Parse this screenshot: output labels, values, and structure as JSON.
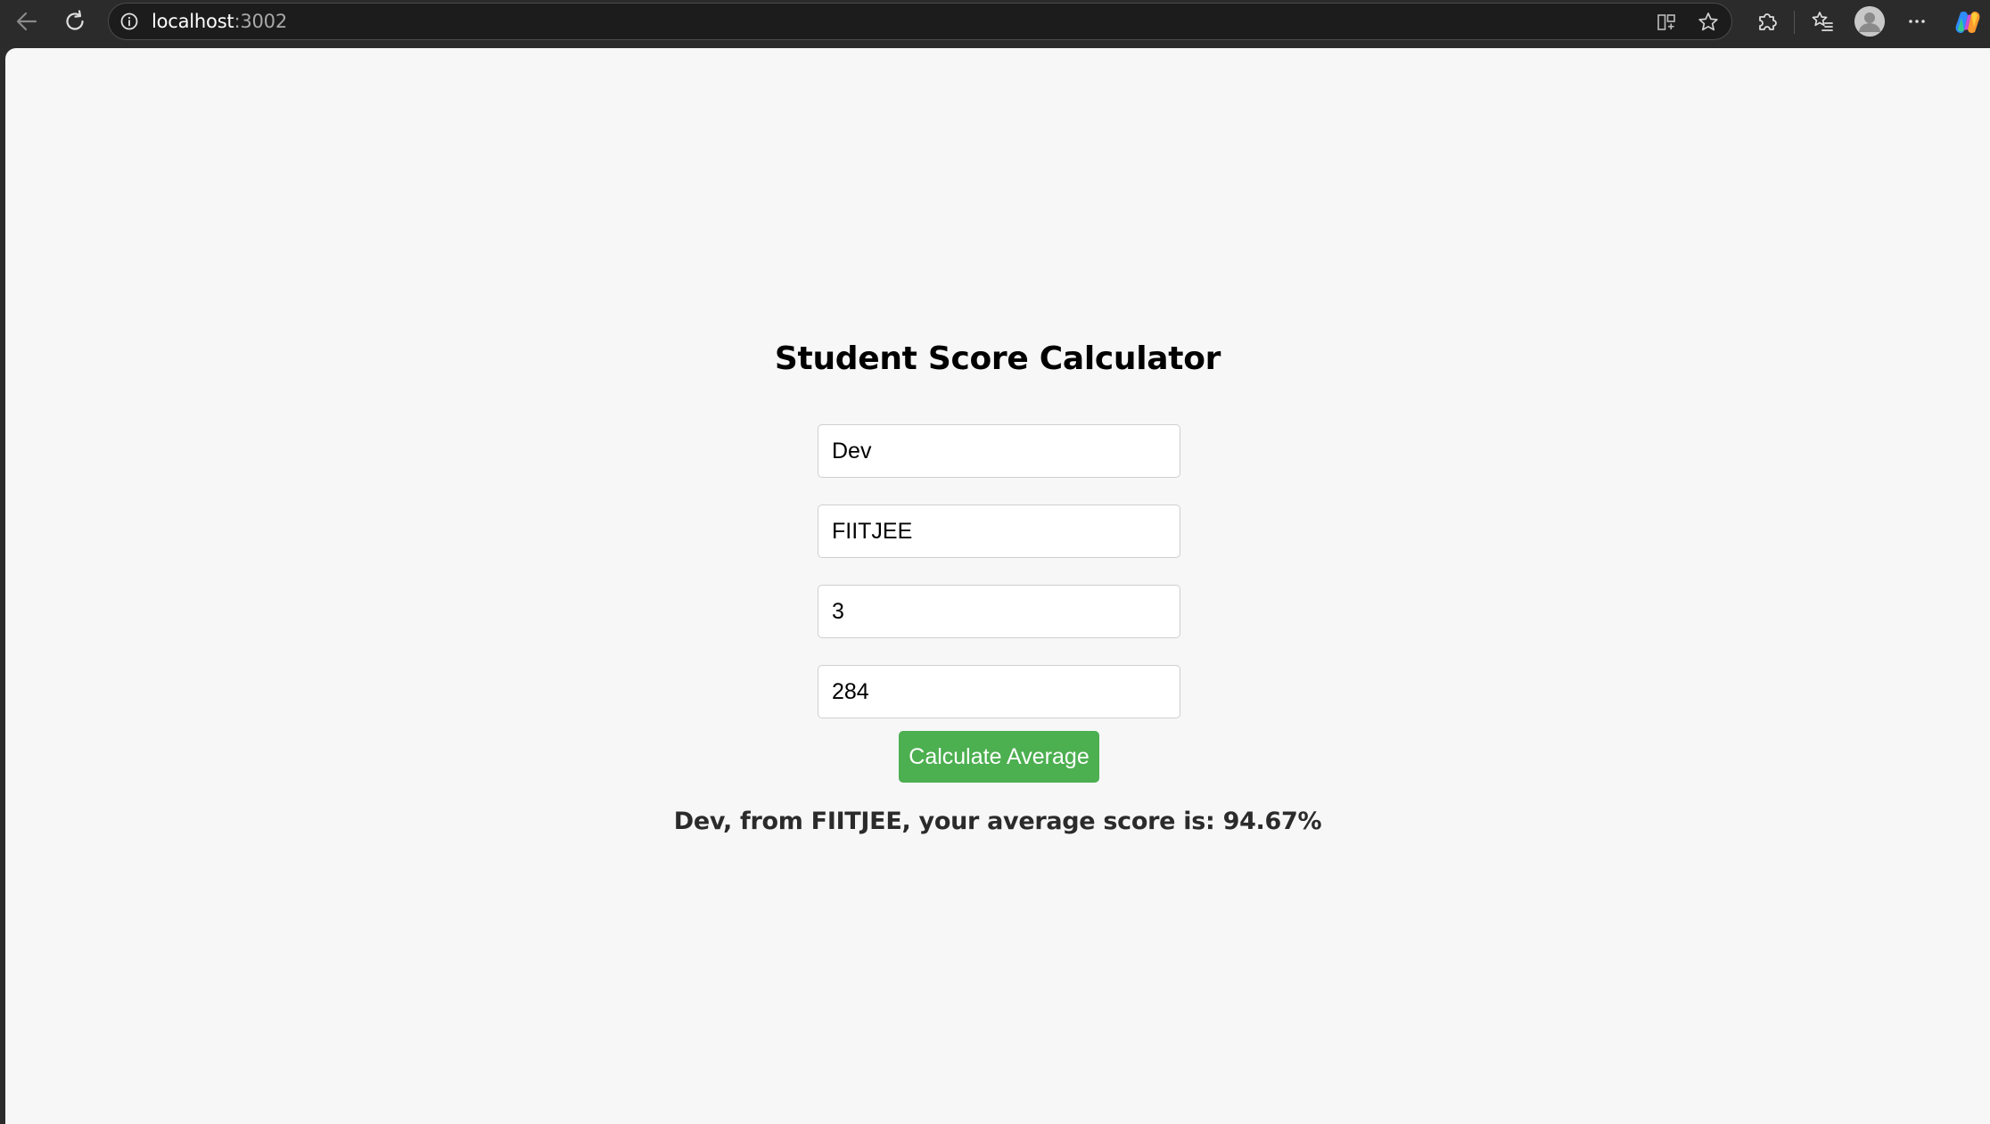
{
  "browser": {
    "url_host": "localhost",
    "url_port": ":3002"
  },
  "page": {
    "title": "Student Score Calculator",
    "fields": [
      {
        "value": "Dev"
      },
      {
        "value": "FIITJEE"
      },
      {
        "value": "3"
      },
      {
        "value": "284"
      }
    ],
    "button_label": "Calculate Average",
    "result_text": "Dev, from FIITJEE, your average score is: 94.67%"
  },
  "colors": {
    "button_bg": "#4caf50",
    "page_bg": "#f7f7f7",
    "toolbar_bg": "#2b2b2b"
  },
  "icons": {
    "back": "arrow-left-icon",
    "reload": "reload-icon",
    "info": "info-icon",
    "split_screen": "split-screen-icon",
    "favorite": "star-icon",
    "extensions": "puzzle-icon",
    "favorites_list": "favorites-icon",
    "profile": "avatar",
    "more": "more-icon",
    "copilot": "copilot-icon"
  }
}
